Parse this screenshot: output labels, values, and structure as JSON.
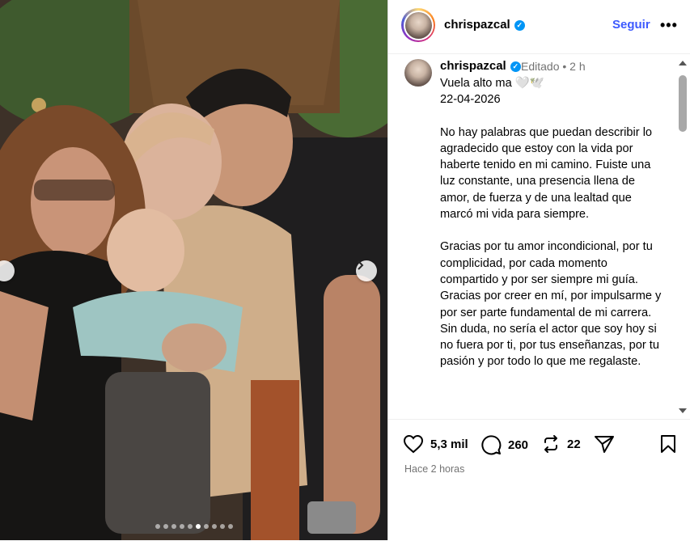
{
  "post": {
    "username": "chrispazcal",
    "follow_label": "Seguir",
    "more_label": "•••",
    "verified_glyph": "✓",
    "edited_label": "Editado",
    "age": "2 h",
    "caption": {
      "line1": "Vuela alto ma 🤍🕊️",
      "date": "22-04-2026",
      "paragraph1": "No hay palabras que puedan describir lo agradecido que estoy con la vida por haberte tenido en mi camino. Fuiste una luz constante, una presencia llena de amor, de fuerza y de una lealtad que marcó mi vida para siempre.",
      "paragraph2": "Gracias por tu amor incondicional, por tu complicidad, por cada momento compartido y por ser siempre mi guía. Gracias por creer en mí, por impulsarme y por ser parte fundamental de mi carrera. Sin duda, no sería el actor que soy hoy si no fuera por ti, por tus enseñanzas, por tu pasión y por todo lo que me regalaste."
    },
    "likes": "5,3 mil",
    "comments": "260",
    "reposts": "22",
    "timestamp": "Hace 2 horas"
  },
  "carousel": {
    "dot_count": 10,
    "active_index": 5
  },
  "colors": {
    "follow": "#3d5afe",
    "verified": "#0095f6",
    "muted": "#737373"
  },
  "icons": [
    "chevron-left-icon",
    "chevron-right-icon",
    "verified-icon",
    "more-icon",
    "heart-icon",
    "comment-icon",
    "repost-icon",
    "share-icon",
    "bookmark-icon"
  ]
}
